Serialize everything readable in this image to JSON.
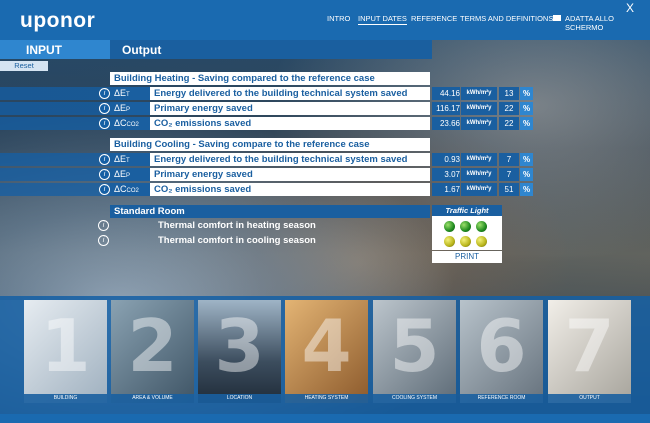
{
  "brand": {
    "logo": "uponor"
  },
  "nav": {
    "items": [
      "INTRO",
      "INPUT DATES",
      "REFERENCE",
      "TERMS AND DEFINITIONS",
      "ADATTA ALLO SCHERMO"
    ],
    "active": "INPUT DATES",
    "close": "X"
  },
  "tabs": {
    "input": "INPUT",
    "output": "Output"
  },
  "reset": "Reset",
  "heating": {
    "title": "Building Heating - Saving compared to the reference case",
    "rows": [
      {
        "sym": "ΔE",
        "sub": "T",
        "label": "Energy delivered to the building technical system saved",
        "value": "44.16",
        "unit": "kWh/m²y",
        "pct": "13",
        "pct_sign": "%"
      },
      {
        "sym": "ΔE",
        "sub": "P",
        "label": "Primary energy saved",
        "value": "116.17",
        "unit": "kWh/m²y",
        "pct": "22",
        "pct_sign": "%"
      },
      {
        "sym": "ΔC",
        "sub": "CO2",
        "label": "CO₂ emissions saved",
        "value": "23.66",
        "unit": "kWh/m²y",
        "pct": "22",
        "pct_sign": "%"
      }
    ]
  },
  "cooling": {
    "title": "Building Cooling - Saving compare to the reference case",
    "rows": [
      {
        "sym": "ΔE",
        "sub": "T",
        "label": "Energy delivered to the building technical system saved",
        "value": "0.93",
        "unit": "kWh/m²y",
        "pct": "7",
        "pct_sign": "%"
      },
      {
        "sym": "ΔE",
        "sub": "P",
        "label": "Primary energy saved",
        "value": "3.07",
        "unit": "kWh/m²y",
        "pct": "7",
        "pct_sign": "%"
      },
      {
        "sym": "ΔC",
        "sub": "CO2",
        "label": "CO₂ emissions saved",
        "value": "1.67",
        "unit": "kWh/m²y",
        "pct": "51",
        "pct_sign": "%"
      }
    ]
  },
  "room": {
    "title": "Standard Room",
    "traffic_light": "Traffic Light",
    "rows": [
      {
        "label": "Thermal comfort in heating season",
        "lights": [
          "green",
          "green",
          "green"
        ]
      },
      {
        "label": "Thermal comfort in cooling season",
        "lights": [
          "yellow",
          "yellow",
          "yellow"
        ]
      }
    ],
    "print": "PRINT"
  },
  "info_glyph": "i",
  "steps": [
    {
      "num": "1",
      "caption": "BUILDING",
      "tone": "#c9d3dc"
    },
    {
      "num": "2",
      "caption": "AREA & VOLUME",
      "tone": "#6e8796"
    },
    {
      "num": "3",
      "caption": "LOCATION",
      "tone": "#5c6e80"
    },
    {
      "num": "4",
      "caption": "HEATING SYSTEM",
      "tone": "#b07f45"
    },
    {
      "num": "5",
      "caption": "COOLING SYSTEM",
      "tone": "#8d99a4"
    },
    {
      "num": "6",
      "caption": "REFERENCE ROOM",
      "tone": "#8f9aa3"
    },
    {
      "num": "7",
      "caption": "OUTPUT",
      "tone": "#d8d4cc"
    }
  ],
  "colors": {
    "brand_blue": "#1a6ab0",
    "dark_blue": "#1a5fa0",
    "light_blue": "#2f86cf"
  }
}
